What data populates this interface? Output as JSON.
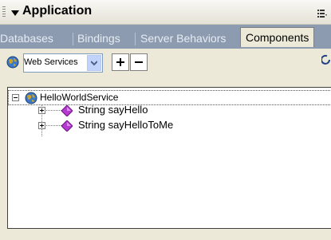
{
  "panel": {
    "title": "Application"
  },
  "tabs": [
    {
      "label": "Databases",
      "active": false
    },
    {
      "label": "Bindings",
      "active": false
    },
    {
      "label": "Server Behaviors",
      "active": false
    },
    {
      "label": "Components",
      "active": true
    }
  ],
  "toolbar": {
    "dropdown_value": "Web Services",
    "add_label": "+",
    "remove_label": "−"
  },
  "tree": {
    "root": {
      "label": "HelloWorldService",
      "icon": "globe-icon",
      "expanded": true
    },
    "children": [
      {
        "label": "String sayHello",
        "icon": "purple-diamond-icon",
        "expanded": false
      },
      {
        "label": "String sayHelloToMe",
        "icon": "purple-diamond-icon",
        "expanded": false
      }
    ]
  },
  "colors": {
    "tab_bar": "#8c9bb0",
    "panel_bg": "#ece9d8",
    "method_icon": "#b53ad0"
  }
}
